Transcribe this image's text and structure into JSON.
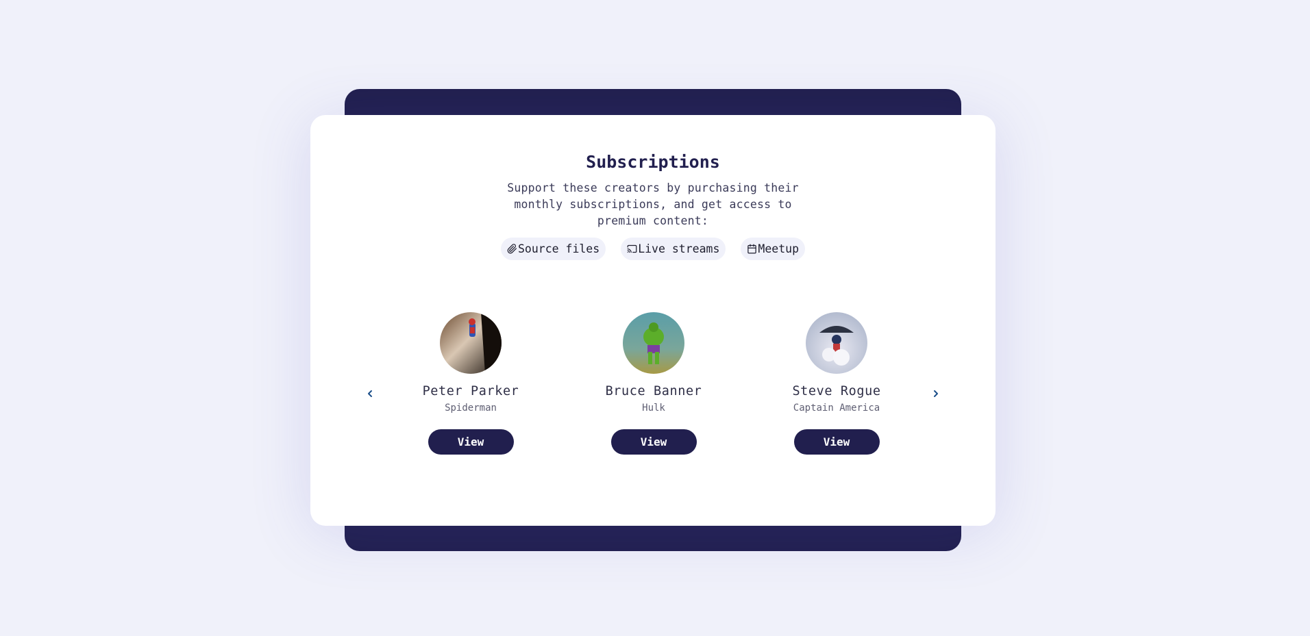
{
  "header": {
    "title": "Subscriptions",
    "description": "Support these creators by purchasing their monthly subscriptions, and get access to premium content:"
  },
  "features": [
    {
      "label": "Source files",
      "icon": "paperclip-icon"
    },
    {
      "label": "Live streams",
      "icon": "cast-icon"
    },
    {
      "label": "Meetup",
      "icon": "calendar-icon"
    }
  ],
  "creators": [
    {
      "name": "Peter Parker",
      "alias": "Spiderman",
      "button": "View"
    },
    {
      "name": "Bruce Banner",
      "alias": "Hulk",
      "button": "View"
    },
    {
      "name": "Steve Rogue",
      "alias": "Captain America",
      "button": "View"
    }
  ],
  "nav": {
    "prev_icon": "chevron-left-icon",
    "next_icon": "chevron-right-icon"
  },
  "colors": {
    "background": "#f0f1fa",
    "accent": "#211f4e",
    "card": "#ffffff",
    "chip": "#f0f1fa",
    "arrow": "#1c4f8a"
  }
}
